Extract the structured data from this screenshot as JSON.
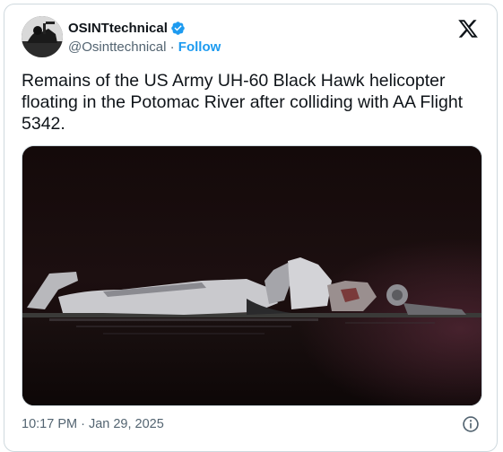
{
  "author": {
    "display_name": "OSINTtechnical",
    "handle": "@Osinttechnical",
    "separator": "·",
    "follow_label": "Follow",
    "verified_color": "#1d9bf0"
  },
  "tweet": {
    "text": "Remains of the US Army UH-60 Black Hawk helicopter\nfloating in the Potomac River after colliding with AA Flight\n5342."
  },
  "media": {
    "description_icon": "photo"
  },
  "footer": {
    "timestamp": "10:17 PM · Jan 29, 2025",
    "info_icon": "info-icon"
  },
  "brand": {
    "logo": "x-logo"
  }
}
